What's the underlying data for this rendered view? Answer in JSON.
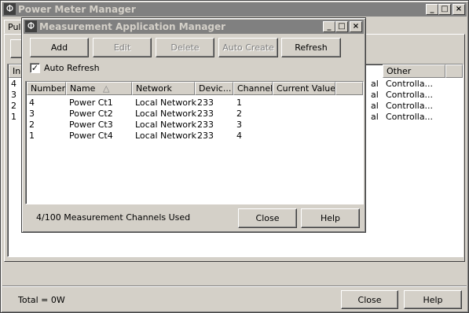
{
  "main_window": {
    "title": "Power Meter Manager",
    "tab_fragment": "Puls",
    "columns": {
      "partial": "In.",
      "other": "Other"
    },
    "rows": [
      {
        "num": "4",
        "mid": "al",
        "other": "Controlla..."
      },
      {
        "num": "3",
        "mid": "al",
        "other": "Controlla..."
      },
      {
        "num": "2",
        "mid": "al",
        "other": "Controlla..."
      },
      {
        "num": "1",
        "mid": "al",
        "other": "Controlla..."
      }
    ],
    "total_label": "Total = 0W",
    "close_label": "Close",
    "help_label": "Help"
  },
  "dialog": {
    "title": "Measurement Application Manager",
    "toolbar": {
      "add": "Add",
      "edit": "Edit",
      "delete": "Delete",
      "auto_create": "Auto Create",
      "refresh": "Refresh"
    },
    "auto_refresh_label": "Auto Refresh",
    "auto_refresh_checked": true,
    "columns": [
      "Number",
      "Name",
      "Network",
      "Devic...",
      "Channel",
      "Current Value"
    ],
    "sort_indicator": "△",
    "rows": [
      {
        "number": "4",
        "name": "Power Ct1",
        "network": "Local Network",
        "device": "233",
        "channel": "1",
        "value": ""
      },
      {
        "number": "3",
        "name": "Power Ct2",
        "network": "Local Network",
        "device": "233",
        "channel": "2",
        "value": ""
      },
      {
        "number": "2",
        "name": "Power Ct3",
        "network": "Local Network",
        "device": "233",
        "channel": "3",
        "value": ""
      },
      {
        "number": "1",
        "name": "Power Ct4",
        "network": "Local Network",
        "device": "233",
        "channel": "4",
        "value": ""
      }
    ],
    "status": "4/100 Measurement Channels Used",
    "close_label": "Close",
    "help_label": "Help"
  },
  "icons": {
    "app_icon_glyph": "Φ"
  }
}
